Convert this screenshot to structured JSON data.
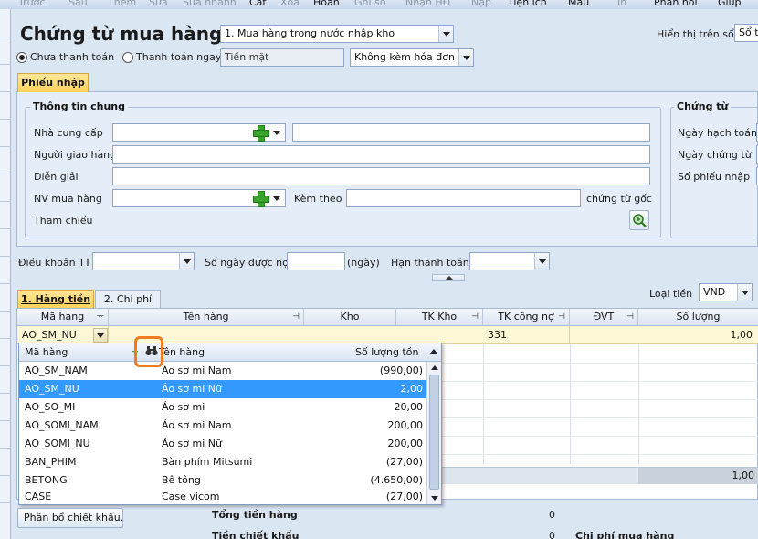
{
  "toolbar": {
    "items": [
      "Trước",
      "Sau",
      "Thêm",
      "Sửa",
      "Sửa nhanh",
      "Cất",
      "Xóa",
      "Hoãn",
      "Ghi sổ",
      "Nhận HĐ",
      "Nạp",
      "Tiện ích",
      "Mẫu",
      "In",
      "Phản hồi",
      "Giúp"
    ]
  },
  "header": {
    "title": "Chứng từ mua hàng",
    "purchase_type": "1. Mua hàng trong nước nhập kho",
    "display_label": "Hiển thị trên sổ",
    "display_value": "Sổ tà",
    "radio_unpaid": "Chưa thanh toán",
    "radio_paid_now": "Thanh toán ngay",
    "payment_method": "Tiền mặt",
    "invoice_option": "Không kèm hóa đơn"
  },
  "tab_phieu_nhap": "Phiếu nhập",
  "general_info": {
    "title": "Thông tin chung",
    "supplier": "Nhà cung cấp",
    "deliverer": "Người giao hàng",
    "description": "Diễn giải",
    "buyer": "NV mua hàng",
    "attached": "Kèm theo",
    "attached_suffix": "chứng từ gốc",
    "reference": "Tham chiếu"
  },
  "voucher": {
    "title": "Chứng từ",
    "posting_date": "Ngày hạch toán",
    "voucher_date": "Ngày chứng từ",
    "receipt_no": "Số phiếu nhập"
  },
  "terms": {
    "payment_terms": "Điều khoản TT",
    "credit_days": "Số ngày được nợ",
    "days_unit": "(ngày)",
    "due_date": "Hạn thanh toán"
  },
  "currency": {
    "label": "Loại tiền",
    "value": "VND"
  },
  "detail_tabs": {
    "goods": "1. Hàng tiền",
    "costs": "2. Chi phí"
  },
  "grid": {
    "columns": [
      "Mã hàng",
      "Tên hàng",
      "Kho",
      "TK Kho",
      "TK công nợ",
      "ĐVT",
      "Số lượng"
    ],
    "row": {
      "code": "AO_SM_NU",
      "account_payable": "331",
      "quantity": "1,00"
    },
    "total_quantity": "1,00"
  },
  "popup": {
    "headers": [
      "Mã hàng",
      "Tên hàng",
      "Số lượng tồn"
    ],
    "rows": [
      {
        "code": "AO_SM_NAM",
        "name": "Áo sơ mi Nam",
        "qty": "(990,00)"
      },
      {
        "code": "AO_SM_NU",
        "name": "Áo sơ mi Nữ",
        "qty": "2,00"
      },
      {
        "code": "AO_SO_MI",
        "name": "Áo sơ mi",
        "qty": "20,00"
      },
      {
        "code": "AO_SOMI_NAM",
        "name": "Áo sơ mi Nam",
        "qty": "200,00"
      },
      {
        "code": "AO_SOMI_NU",
        "name": "Áo sơ mi Nữ",
        "qty": "200,00"
      },
      {
        "code": "BAN_PHIM",
        "name": "Bàn phím Mitsumi",
        "qty": "(27,00)"
      },
      {
        "code": "BETONG",
        "name": "Bê tông",
        "qty": "(4.650,00)"
      },
      {
        "code": "CASE",
        "name": "Case vicom",
        "qty": "(27,00)"
      }
    ],
    "selected_index": 1
  },
  "footer": {
    "discount_alloc": "Phân bổ chiết khấu...",
    "total_goods": "Tổng tiền hàng",
    "total_goods_value": "0",
    "discount": "Tiền chiết khấu",
    "discount_value": "0",
    "purchase_cost": "Chi phí mua hàng"
  },
  "colors": {
    "accent_tab": "#ffd35a",
    "selection": "#3399ff",
    "highlight_box": "#f07c1e"
  }
}
